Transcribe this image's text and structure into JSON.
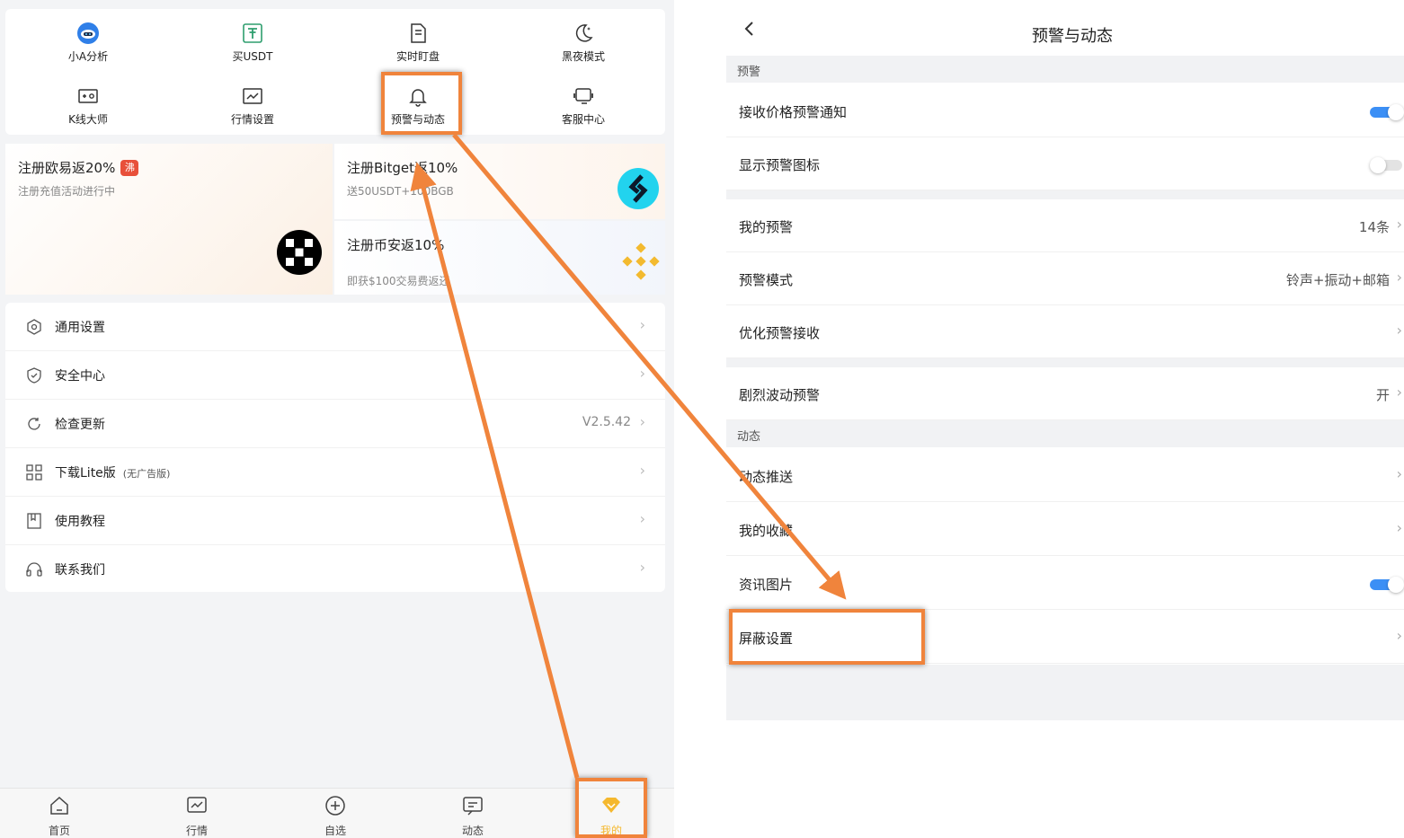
{
  "left": {
    "quick_actions": [
      {
        "label": "小A分析",
        "icon": "robot-icon"
      },
      {
        "label": "买USDT",
        "icon": "tether-icon"
      },
      {
        "label": "实时盯盘",
        "icon": "monitor-doc-icon"
      },
      {
        "label": "黑夜模式",
        "icon": "moon-icon"
      },
      {
        "label": "K线大师",
        "icon": "kline-icon"
      },
      {
        "label": "行情设置",
        "icon": "chart-icon"
      },
      {
        "label": "预警与动态",
        "icon": "bell-icon"
      },
      {
        "label": "客服中心",
        "icon": "support-icon"
      }
    ],
    "banners": [
      {
        "title": "注册欧易返20%",
        "badge": "沸",
        "subtitle": "注册充值活动进行中",
        "logo": "okx-logo"
      },
      {
        "title": "注册Bitget返10%",
        "subtitle": "送50USDT+100BGB",
        "logo": "bitget-logo"
      },
      {
        "title": "注册币安返10%",
        "subtitle": "即获$100交易费返还",
        "logo": "binance-logo"
      }
    ],
    "menu": [
      {
        "label": "通用设置",
        "icon": "hexagon-settings-icon"
      },
      {
        "label": "安全中心",
        "icon": "shield-icon"
      },
      {
        "label": "检查更新",
        "icon": "refresh-icon",
        "value": "V2.5.42"
      },
      {
        "label": "下载Lite版",
        "sub": "(无广告版)",
        "icon": "grid-icon"
      },
      {
        "label": "使用教程",
        "icon": "book-icon"
      },
      {
        "label": "联系我们",
        "icon": "headset-icon"
      }
    ],
    "tabs": [
      {
        "label": "首页",
        "icon": "home-icon"
      },
      {
        "label": "行情",
        "icon": "market-icon"
      },
      {
        "label": "自选",
        "icon": "add-circle-icon"
      },
      {
        "label": "动态",
        "icon": "message-icon"
      },
      {
        "label": "我的",
        "icon": "diamond-icon",
        "active": true
      }
    ]
  },
  "right": {
    "title": "预警与动态",
    "section_alert": "预警",
    "section_feed": "动态",
    "items": {
      "receive_price_alert": {
        "label": "接收价格预警通知",
        "toggle": true
      },
      "show_alert_icon": {
        "label": "显示预警图标",
        "toggle": false
      },
      "my_alerts": {
        "label": "我的预警",
        "value": "14条"
      },
      "alert_mode": {
        "label": "预警模式",
        "value": "铃声+振动+邮箱"
      },
      "optimize_receive": {
        "label": "优化预警接收"
      },
      "volatility_alert": {
        "label": "剧烈波动预警",
        "value": "开"
      },
      "feed_push": {
        "label": "动态推送"
      },
      "my_favorites": {
        "label": "我的收藏"
      },
      "news_images": {
        "label": "资讯图片",
        "toggle": true
      },
      "block_settings": {
        "label": "屏蔽设置"
      }
    }
  },
  "colors": {
    "accent": "#f0843c",
    "toggle_on": "#3b8ff5",
    "toggle_off": "#e3e3e3",
    "active_tab": "#f5b82e"
  }
}
